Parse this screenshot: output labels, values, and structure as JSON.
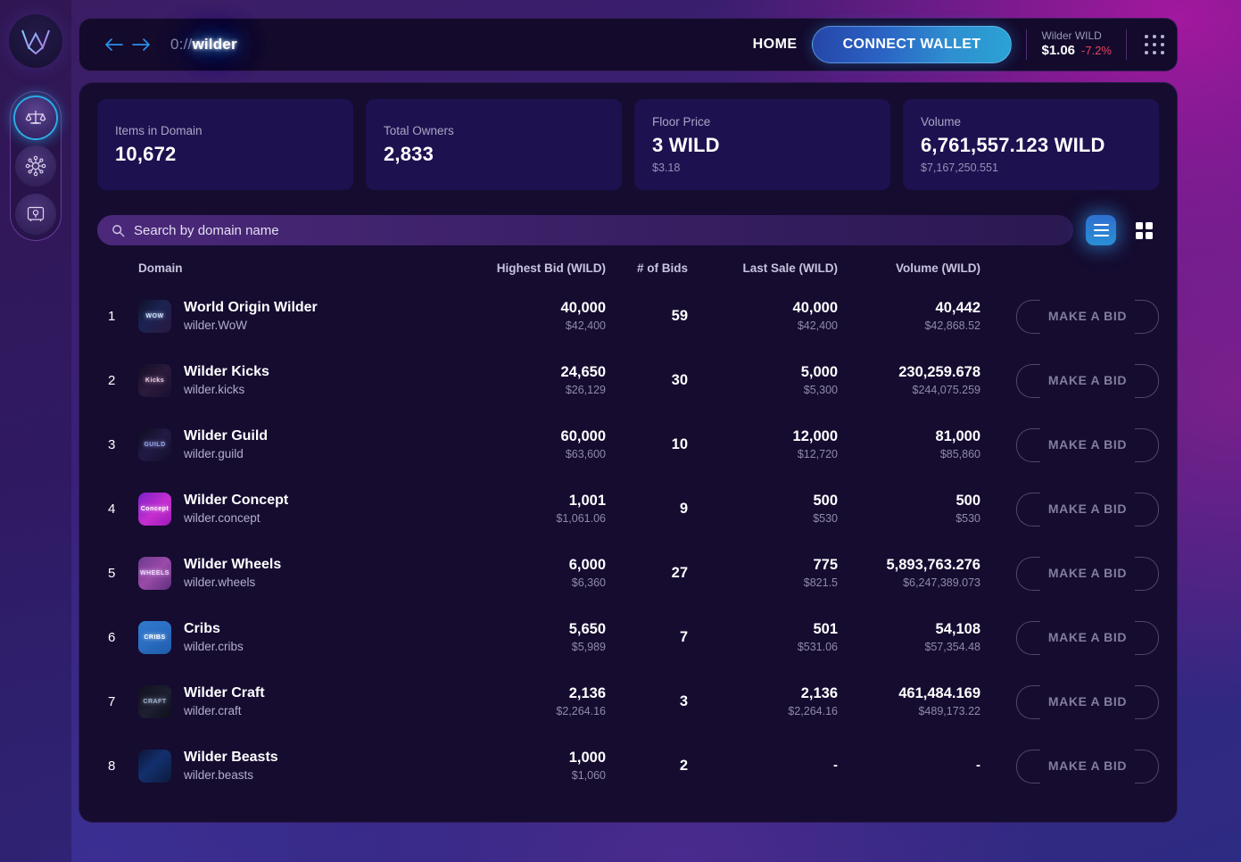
{
  "sidebar": {
    "logo": "wilder-w-logo",
    "items": [
      {
        "name": "sidebar-item-staking",
        "icon": "scales-icon",
        "active": true
      },
      {
        "name": "sidebar-item-network",
        "icon": "network-hub-icon",
        "active": false
      },
      {
        "name": "sidebar-item-vault",
        "icon": "safe-vault-icon",
        "active": false
      }
    ]
  },
  "topbar": {
    "back_icon": "arrow-left-icon",
    "forward_icon": "arrow-right-icon",
    "route_scheme": "0://",
    "route_name": "wilder",
    "home_label": "HOME",
    "connect_label": "CONNECT WALLET",
    "token_name": "Wilder WILD",
    "token_price": "$1.06",
    "token_change": "-7.2%",
    "token_change_color": "#e8455f",
    "apps_icon": "grid-dots-icon"
  },
  "stats": [
    {
      "label": "Items in Domain",
      "value": "10,672",
      "sub": ""
    },
    {
      "label": "Total Owners",
      "value": "2,833",
      "sub": ""
    },
    {
      "label": "Floor Price",
      "value": "3 WILD",
      "sub": "$3.18"
    },
    {
      "label": "Volume",
      "value": "6,761,557.123 WILD",
      "sub": "$7,167,250.551"
    }
  ],
  "search": {
    "icon": "search-icon",
    "placeholder": "Search by domain name",
    "value": ""
  },
  "view_toggle": {
    "list_label": "list-view",
    "grid_label": "grid-view",
    "active": "list"
  },
  "table": {
    "headers": {
      "rank": "",
      "domain": "Domain",
      "highest_bid": "Highest Bid (WILD)",
      "num_bids": "# of Bids",
      "last_sale": "Last Sale (WILD)",
      "volume": "Volume (WILD)",
      "action": ""
    },
    "action_label": "MAKE A BID",
    "rows": [
      {
        "rank": "1",
        "title": "World Origin Wilder",
        "domain": "wilder.WoW",
        "bid": "40,000",
        "bid_usd": "$42,400",
        "bids": "59",
        "sale": "40,000",
        "sale_usd": "$42,400",
        "vol": "40,442",
        "vol_usd": "$42,868.52",
        "thumb": "wow-thumbnail"
      },
      {
        "rank": "2",
        "title": "Wilder Kicks",
        "domain": "wilder.kicks",
        "bid": "24,650",
        "bid_usd": "$26,129",
        "bids": "30",
        "sale": "5,000",
        "sale_usd": "$5,300",
        "vol": "230,259.678",
        "vol_usd": "$244,075.259",
        "thumb": "kicks-thumbnail"
      },
      {
        "rank": "3",
        "title": "Wilder Guild",
        "domain": "wilder.guild",
        "bid": "60,000",
        "bid_usd": "$63,600",
        "bids": "10",
        "sale": "12,000",
        "sale_usd": "$12,720",
        "vol": "81,000",
        "vol_usd": "$85,860",
        "thumb": "guild-thumbnail"
      },
      {
        "rank": "4",
        "title": "Wilder Concept",
        "domain": "wilder.concept",
        "bid": "1,001",
        "bid_usd": "$1,061.06",
        "bids": "9",
        "sale": "500",
        "sale_usd": "$530",
        "vol": "500",
        "vol_usd": "$530",
        "thumb": "concept-thumbnail"
      },
      {
        "rank": "5",
        "title": "Wilder Wheels",
        "domain": "wilder.wheels",
        "bid": "6,000",
        "bid_usd": "$6,360",
        "bids": "27",
        "sale": "775",
        "sale_usd": "$821.5",
        "vol": "5,893,763.276",
        "vol_usd": "$6,247,389.073",
        "thumb": "wheels-thumbnail"
      },
      {
        "rank": "6",
        "title": "Cribs",
        "domain": "wilder.cribs",
        "bid": "5,650",
        "bid_usd": "$5,989",
        "bids": "7",
        "sale": "501",
        "sale_usd": "$531.06",
        "vol": "54,108",
        "vol_usd": "$57,354.48",
        "thumb": "cribs-thumbnail"
      },
      {
        "rank": "7",
        "title": "Wilder Craft",
        "domain": "wilder.craft",
        "bid": "2,136",
        "bid_usd": "$2,264.16",
        "bids": "3",
        "sale": "2,136",
        "sale_usd": "$2,264.16",
        "vol": "461,484.169",
        "vol_usd": "$489,173.22",
        "thumb": "craft-thumbnail"
      },
      {
        "rank": "8",
        "title": "Wilder Beasts",
        "domain": "wilder.beasts",
        "bid": "1,000",
        "bid_usd": "$1,060",
        "bids": "2",
        "sale": "-",
        "sale_usd": "",
        "vol": "-",
        "vol_usd": "",
        "thumb": "beasts-thumbnail"
      }
    ]
  }
}
